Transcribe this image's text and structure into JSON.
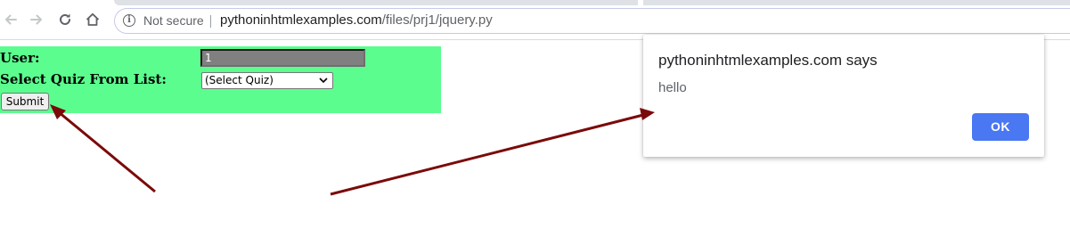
{
  "browser": {
    "security_label": "Not secure",
    "url_host": "pythoninhtmlexamples.com",
    "url_path": "/files/prj1/jquery.py"
  },
  "form": {
    "background_color": "#5cfd8f",
    "user_label": "User:",
    "user_value": "1",
    "quiz_label": "Select Quiz From List:",
    "quiz_selected": "(Select Quiz)",
    "submit_label": "Submit"
  },
  "dialog": {
    "title": "pythoninhtmlexamples.com says",
    "message": "hello",
    "ok_label": "OK",
    "ok_color": "#4a77f2"
  },
  "annotations": {
    "arrow_color": "#7b0a0a"
  },
  "icons": [
    "back-arrow-icon",
    "forward-arrow-icon",
    "reload-icon",
    "home-icon",
    "info-icon",
    "chevron-down-icon"
  ]
}
